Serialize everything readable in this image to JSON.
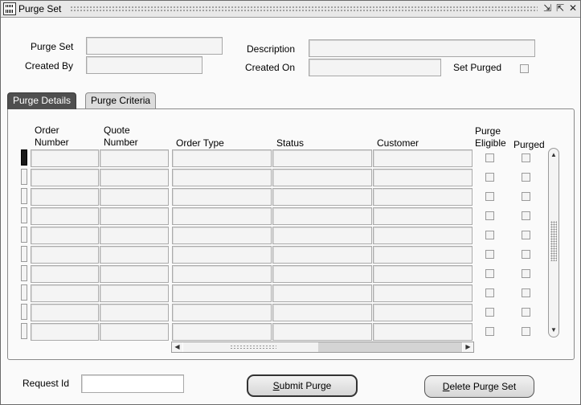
{
  "window": {
    "title": "Purge Set",
    "controls": [
      "⇲",
      "⇱",
      "✕"
    ]
  },
  "header": {
    "purge_set_label": "Purge Set",
    "purge_set_value": "",
    "created_by_label": "Created By",
    "created_by_value": "",
    "description_label": "Description",
    "description_value": "",
    "created_on_label": "Created On",
    "created_on_value": "",
    "set_purged_label": "Set Purged"
  },
  "tabs": [
    {
      "label": "Purge Details",
      "active": true
    },
    {
      "label": "Purge Criteria",
      "active": false
    }
  ],
  "table": {
    "columns": [
      {
        "label": "Order\nNumber"
      },
      {
        "label": "Quote\nNumber"
      },
      {
        "label": "Order Type"
      },
      {
        "label": "Status"
      },
      {
        "label": "Customer"
      },
      {
        "label": "Purge\nEligible"
      },
      {
        "label": "Purged"
      }
    ],
    "row_count": 10,
    "rows": [
      {
        "order_number": "",
        "quote_number": "",
        "order_type": "",
        "status": "",
        "customer": "",
        "purge_eligible": false,
        "purged": false
      },
      {
        "order_number": "",
        "quote_number": "",
        "order_type": "",
        "status": "",
        "customer": "",
        "purge_eligible": false,
        "purged": false
      },
      {
        "order_number": "",
        "quote_number": "",
        "order_type": "",
        "status": "",
        "customer": "",
        "purge_eligible": false,
        "purged": false
      },
      {
        "order_number": "",
        "quote_number": "",
        "order_type": "",
        "status": "",
        "customer": "",
        "purge_eligible": false,
        "purged": false
      },
      {
        "order_number": "",
        "quote_number": "",
        "order_type": "",
        "status": "",
        "customer": "",
        "purge_eligible": false,
        "purged": false
      },
      {
        "order_number": "",
        "quote_number": "",
        "order_type": "",
        "status": "",
        "customer": "",
        "purge_eligible": false,
        "purged": false
      },
      {
        "order_number": "",
        "quote_number": "",
        "order_type": "",
        "status": "",
        "customer": "",
        "purge_eligible": false,
        "purged": false
      },
      {
        "order_number": "",
        "quote_number": "",
        "order_type": "",
        "status": "",
        "customer": "",
        "purge_eligible": false,
        "purged": false
      },
      {
        "order_number": "",
        "quote_number": "",
        "order_type": "",
        "status": "",
        "customer": "",
        "purge_eligible": false,
        "purged": false
      },
      {
        "order_number": "",
        "quote_number": "",
        "order_type": "",
        "status": "",
        "customer": "",
        "purge_eligible": false,
        "purged": false
      }
    ]
  },
  "footer": {
    "request_id_label": "Request Id",
    "request_id_value": "",
    "submit_button": {
      "mnemonic": "S",
      "rest": "ubmit Purge"
    },
    "delete_button": {
      "mnemonic": "D",
      "rest": "elete Purge Set"
    }
  },
  "icons": {
    "app": "form-window-icon",
    "set_purged": "checkbox-icon",
    "scroll_up": "arrow-up-icon",
    "scroll_down": "arrow-down-icon",
    "scroll_left": "arrow-left-icon",
    "scroll_right": "arrow-right-icon"
  },
  "colors": {
    "active_tab_bg": "#4f4f4f",
    "field_bg": "#f4f4f4",
    "window_bg": "#fafafa"
  }
}
